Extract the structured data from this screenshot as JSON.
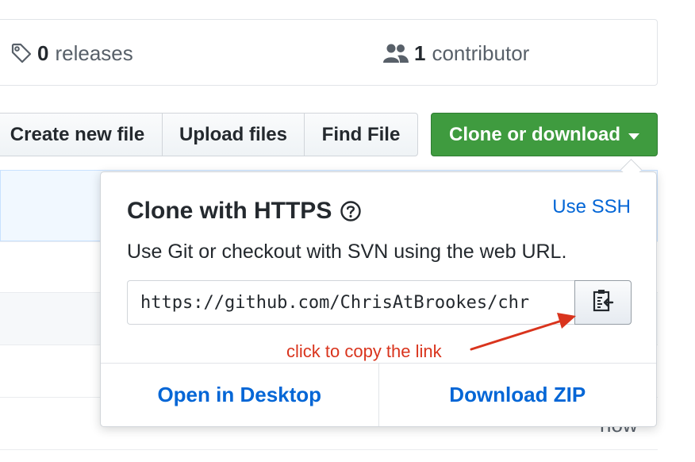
{
  "summary": {
    "releases": {
      "count": "0",
      "label": "releases",
      "icon": "tag-icon"
    },
    "contributors": {
      "count": "1",
      "label": "contributor",
      "icon": "people-icon"
    }
  },
  "toolbar": {
    "create_file": "Create new file",
    "upload_files": "Upload files",
    "find_file": "Find File",
    "clone_download": "Clone or download"
  },
  "background": {
    "age_text": "now"
  },
  "clone_popover": {
    "title": "Clone with HTTPS",
    "help_icon": "question-circle-icon",
    "use_ssh": "Use SSH",
    "description": "Use Git or checkout with SVN using the web URL.",
    "url_value": "https://github.com/ChrisAtBrookes/chr",
    "copy_icon": "clipboard-icon",
    "open_desktop": "Open in Desktop",
    "download_zip": "Download ZIP"
  },
  "annotation": {
    "text": "click to copy the link",
    "color": "#d9341d"
  },
  "colors": {
    "primary_green": "#3f9b3f",
    "link_blue": "#0366d6"
  }
}
